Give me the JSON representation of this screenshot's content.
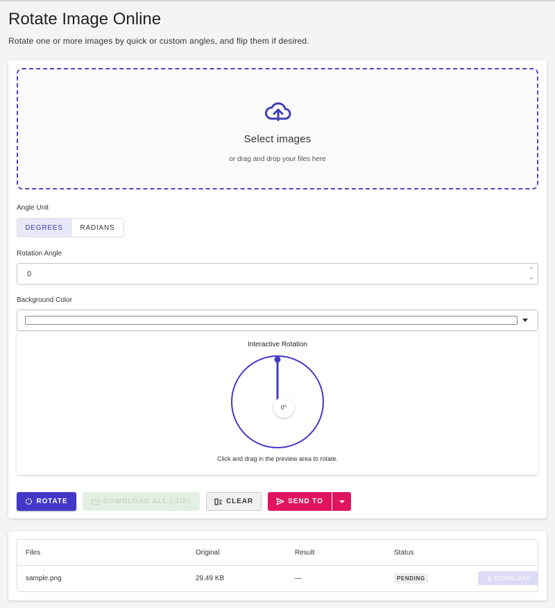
{
  "header": {
    "title": "Rotate Image Online",
    "subtitle": "Rotate one or more images by quick or custom angles, and flip them if desired."
  },
  "dropzone": {
    "label": "Select images",
    "hint": "or drag and drop your files here",
    "icon": "cloud-upload-icon"
  },
  "angle_unit": {
    "label": "Angle Unit",
    "options": [
      "DEGREES",
      "RADIANS"
    ],
    "selected": "DEGREES"
  },
  "rotation_angle": {
    "label": "Rotation Angle",
    "value": "0"
  },
  "background_color": {
    "label": "Background Color",
    "value": "#ffffff"
  },
  "interactive_rotation": {
    "title": "Interactive Rotation",
    "angle_readout": "0°",
    "hint": "Click and drag in the preview area to rotate.",
    "angle_degrees": 0
  },
  "actions": {
    "rotate": "ROTATE",
    "download_all": "DOWNLOAD ALL (.ZIP)",
    "clear": "CLEAR",
    "send_to": "SEND TO"
  },
  "files_table": {
    "headers": [
      "Files",
      "Original",
      "Result",
      "Status"
    ],
    "rows": [
      {
        "file": "sample.png",
        "original": "29.49 KB",
        "result": "—",
        "status": "PENDING",
        "action": "DOWNLOAD"
      }
    ]
  },
  "colors": {
    "accent": "#4338c9",
    "send_to": "#e0135e",
    "dropzone_border": "#4a4ab8"
  }
}
